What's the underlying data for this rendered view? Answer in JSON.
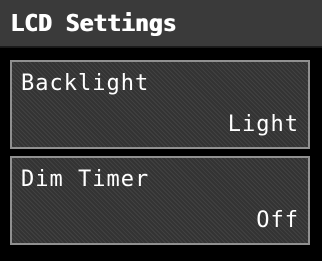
{
  "title": "LCD Settings",
  "items": [
    {
      "label": "Backlight",
      "value": "Light"
    },
    {
      "label": "Dim Timer",
      "value": "Off"
    }
  ],
  "colors": {
    "screen_background": "#000000",
    "title_bar_background": "#3a3a3a",
    "item_background": "#333333",
    "item_border": "#909090",
    "text": "#ffffff"
  }
}
